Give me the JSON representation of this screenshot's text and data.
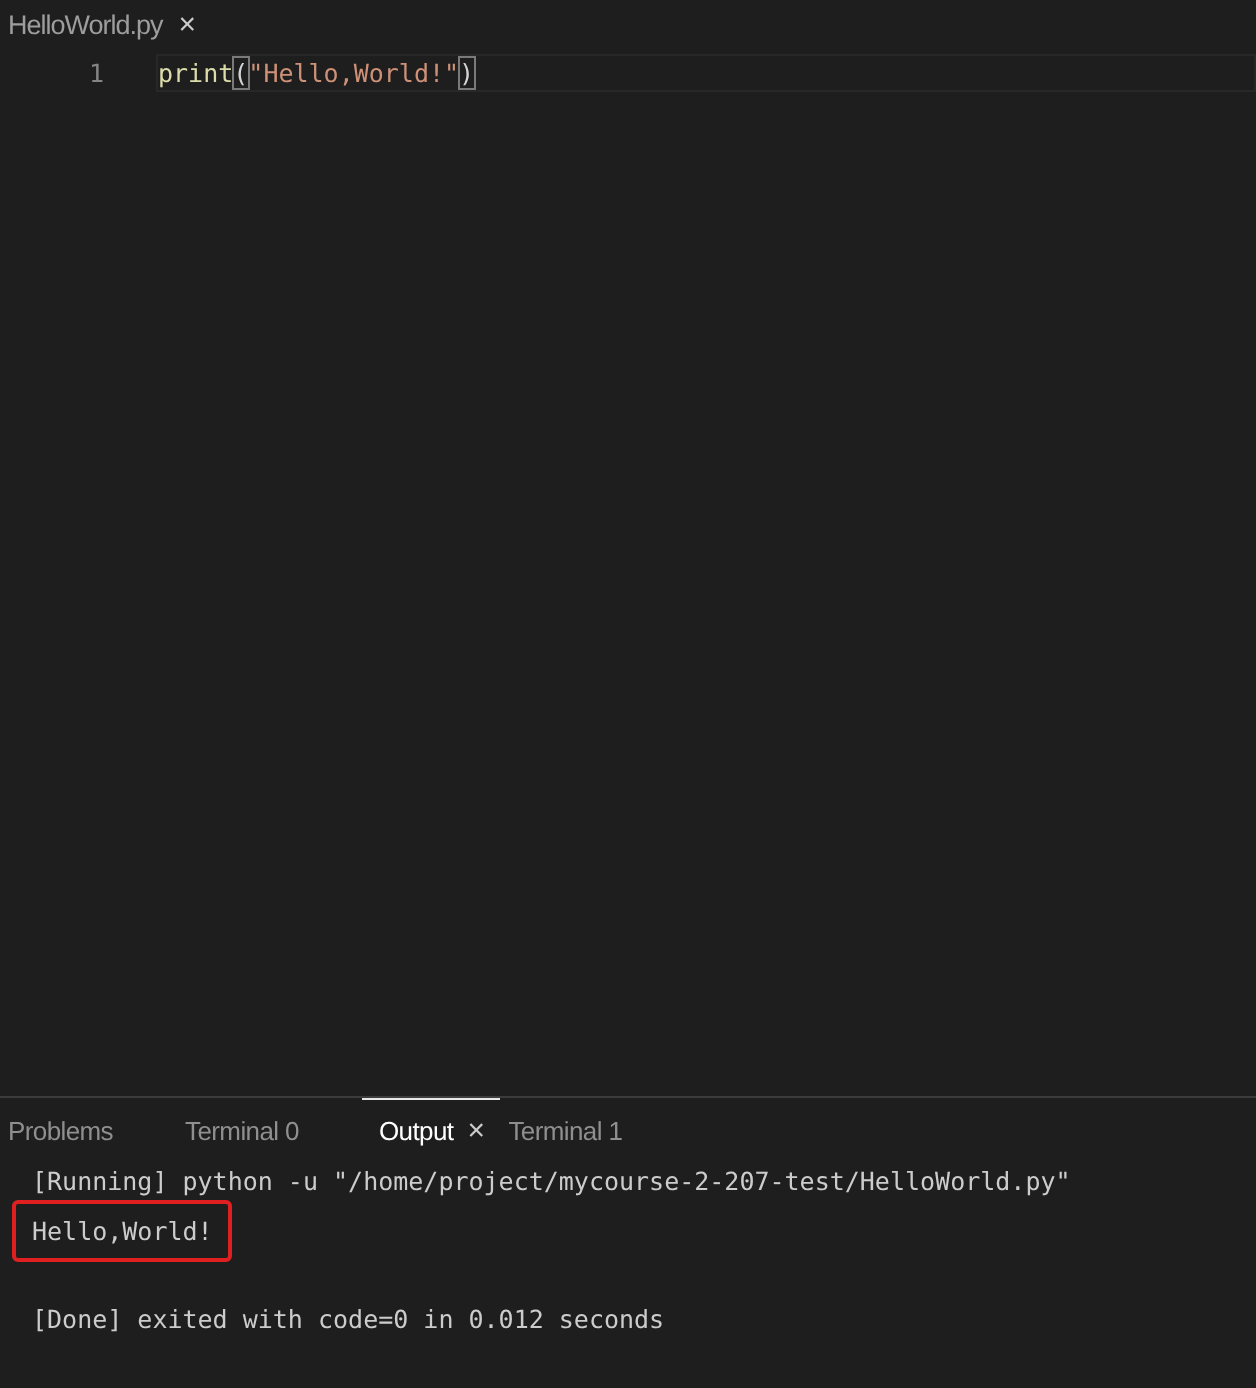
{
  "editor_tab": {
    "label": "HelloWorld.py",
    "close": "×"
  },
  "code_lines": [
    {
      "number": "1",
      "tokens": [
        {
          "kind": "function",
          "text": "print"
        },
        {
          "kind": "bracket",
          "text": "("
        },
        {
          "kind": "string",
          "text": "\"Hello,World!\""
        },
        {
          "kind": "bracket",
          "text": ")"
        }
      ]
    }
  ],
  "panel_tabs": [
    {
      "label": "Problems",
      "selected": false
    },
    {
      "label": "Terminal 0",
      "selected": false
    },
    {
      "label": "Output",
      "selected": true,
      "close": "×"
    },
    {
      "label": "Terminal 1",
      "selected": false
    }
  ],
  "output_lines": [
    {
      "text": "[Running] python -u \"/home/project/mycourse-2-207-test/HelloWorld.py\"",
      "highlighted": false
    },
    {
      "text": "Hello,World!",
      "highlighted": true
    },
    {
      "text": "[Done] exited with code=0 in 0.012 seconds",
      "highlighted": false,
      "gap_before": true
    }
  ]
}
